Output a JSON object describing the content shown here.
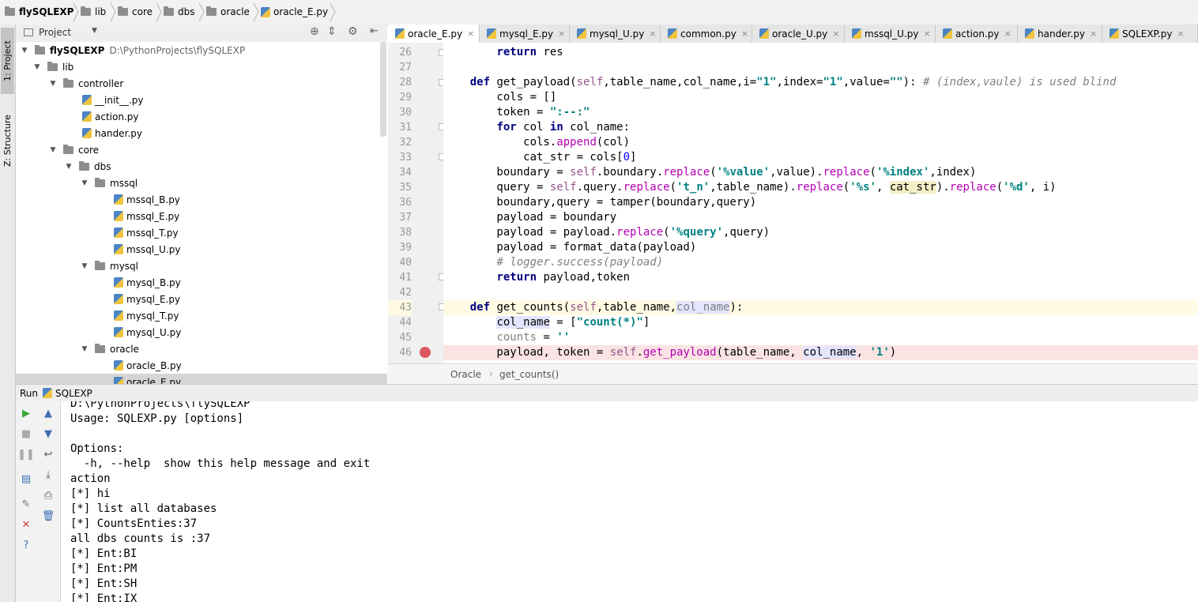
{
  "breadcrumb": {
    "items": [
      "flySQLEXP",
      "lib",
      "core",
      "dbs",
      "oracle",
      "oracle_E.py"
    ]
  },
  "tool_windows": {
    "left": [
      "1: Project",
      "Z: Structure"
    ]
  },
  "project": {
    "title": "Project",
    "root_name": "flySQLEXP",
    "root_path": "D:\\PythonProjects\\flySQLEXP",
    "nodes": [
      "lib",
      "controller",
      "__init__.py",
      "action.py",
      "hander.py",
      "core",
      "dbs",
      "mssql",
      "mssql_B.py",
      "mssql_E.py",
      "mssql_T.py",
      "mssql_U.py",
      "mysql",
      "mysql_B.py",
      "mysql_E.py",
      "mysql_T.py",
      "mysql_U.py",
      "oracle",
      "oracle_B.py",
      "oracle_E.py"
    ]
  },
  "tabs": [
    "oracle_E.py",
    "mysql_E.py",
    "mysql_U.py",
    "common.py",
    "oracle_U.py",
    "mssql_U.py",
    "action.py",
    "hander.py",
    "SQLEXP.py"
  ],
  "editor": {
    "line_numbers": [
      "26",
      "27",
      "28",
      "29",
      "30",
      "31",
      "32",
      "33",
      "34",
      "35",
      "36",
      "37",
      "38",
      "39",
      "40",
      "41",
      "42",
      "43",
      "44",
      "45",
      "46"
    ],
    "crumb": [
      "Oracle",
      "get_counts()"
    ]
  },
  "run": {
    "label": "Run",
    "config": "SQLEXP",
    "output": [
      "D:\\PythonProjects\\flySQLEXP",
      "Usage: SQLEXP.py [options]",
      "",
      "Options:",
      "  -h, --help  show this help message and exit",
      "action",
      "[*] hi",
      "[*] list all databases",
      "[*] CountsEnties:37",
      "all dbs counts is :37",
      "[*] Ent:BI",
      "[*] Ent:PM",
      "[*] Ent:SH",
      "[*] Ent:IX"
    ]
  },
  "colors": {
    "keyword": "#000080",
    "string": "#008080",
    "comment": "#808080",
    "self": "#94558d",
    "breakpoint": "#db5860",
    "current_line": "#fffae3",
    "breakpoint_line": "#fae3e3"
  }
}
